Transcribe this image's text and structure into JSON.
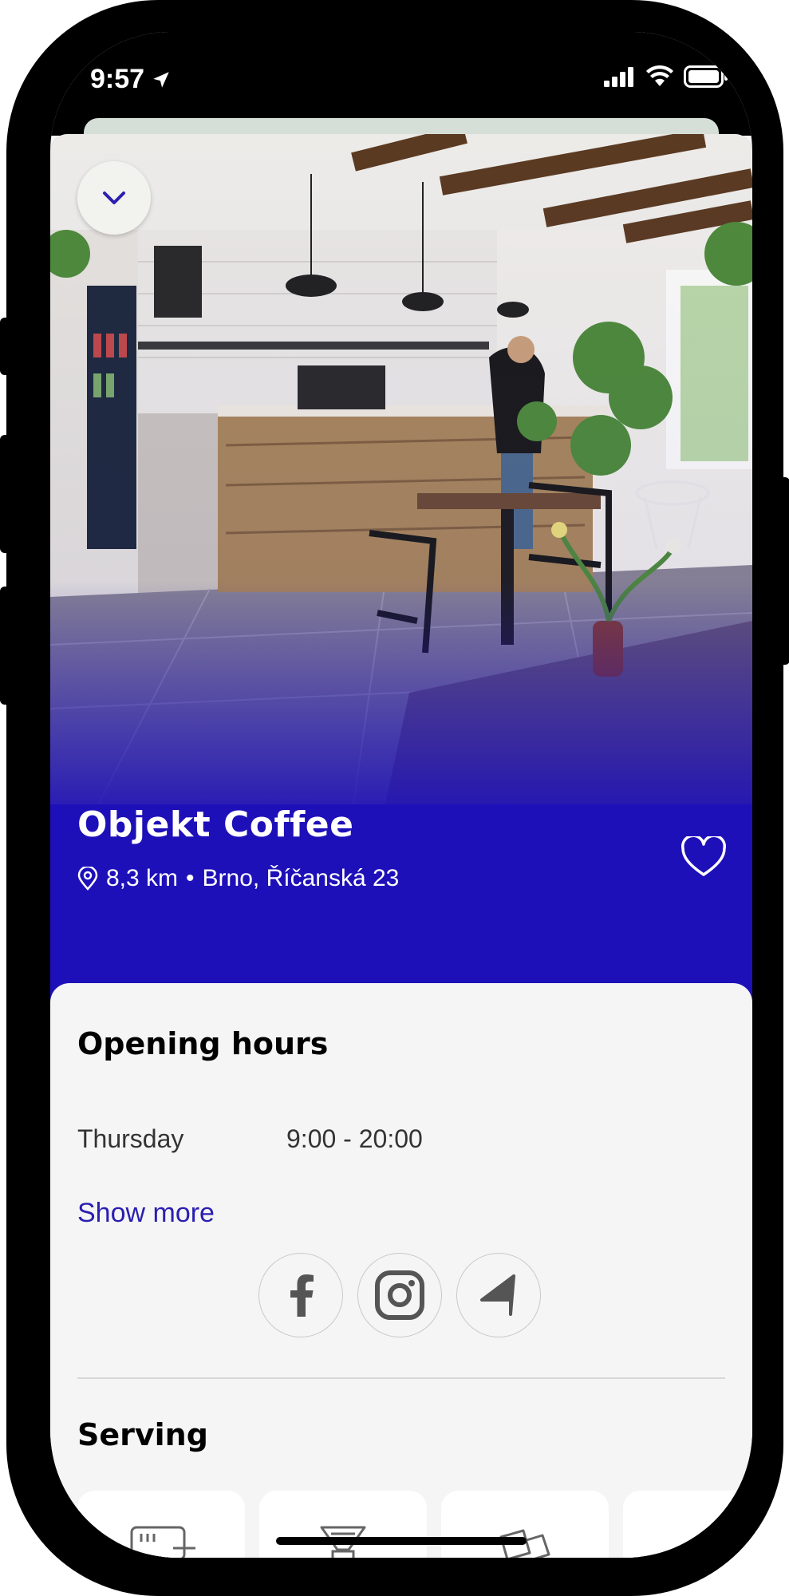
{
  "status_bar": {
    "time": "9:57"
  },
  "venue": {
    "name": "Objekt Coffee",
    "distance": "8,3 km",
    "separator": "•",
    "address": "Brno, Říčanská 23"
  },
  "opening_hours": {
    "title": "Opening hours",
    "day": "Thursday",
    "hours": "9:00 - 20:00",
    "show_more": "Show more"
  },
  "socials": [
    "facebook-icon",
    "instagram-icon",
    "navigate-icon"
  ],
  "serving": {
    "title": "Serving"
  },
  "colors": {
    "brand": "#1e10b8",
    "link": "#2a1fb0",
    "background": "#f5f5f5"
  }
}
